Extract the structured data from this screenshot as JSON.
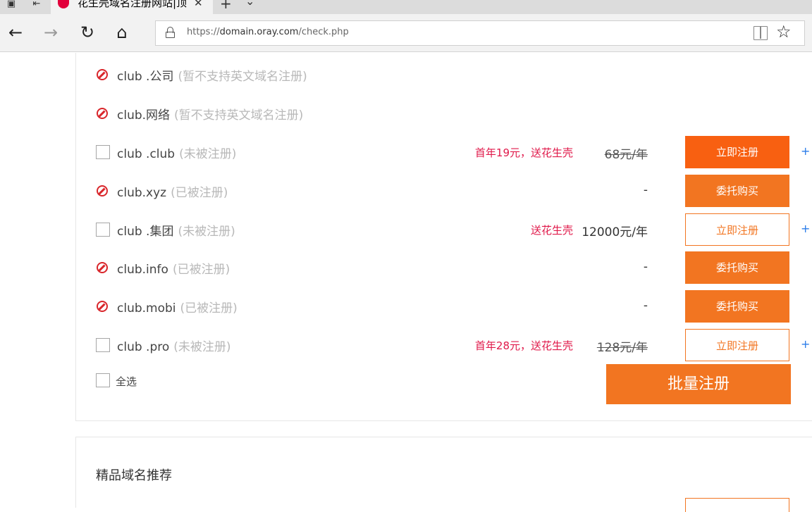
{
  "browser": {
    "tab_title": "花生壳域名注册网站|顶",
    "new_tab_symbol": "+",
    "address_url_prefix": "https://",
    "address_url_domain": "domain.oray.com",
    "address_url_path": "/check.php"
  },
  "rows": [
    {
      "type": "blocked",
      "domain": "club .公司",
      "status": "(暂不支持英文域名注册)"
    },
    {
      "type": "blocked",
      "domain": "club.网络",
      "status": "(暂不支持英文域名注册)"
    },
    {
      "type": "available",
      "domain": "club .club",
      "status": "(未被注册)",
      "promo": "首年19元，送花生壳",
      "price": "68元/年",
      "price_struck": true,
      "button": "立即注册",
      "button_style": "solid2",
      "plus": "+"
    },
    {
      "type": "taken",
      "domain": "club.xyz",
      "status": "(已被注册)",
      "promo": "",
      "price": "-",
      "price_struck": false,
      "button": "委托购买",
      "button_style": "solid"
    },
    {
      "type": "available",
      "domain": "club .集团",
      "status": "(未被注册)",
      "promo": "送花生壳",
      "price": "12000元/年",
      "price_struck": false,
      "button": "立即注册",
      "button_style": "outline",
      "plus": "+"
    },
    {
      "type": "taken",
      "domain": "club.info",
      "status": "(已被注册)",
      "promo": "",
      "price": "-",
      "price_struck": false,
      "button": "委托购买",
      "button_style": "solid"
    },
    {
      "type": "taken",
      "domain": "club.mobi",
      "status": "(已被注册)",
      "promo": "",
      "price": "-",
      "price_struck": false,
      "button": "委托购买",
      "button_style": "solid"
    },
    {
      "type": "available",
      "domain": "club .pro",
      "status": "(未被注册)",
      "promo": "首年28元，送花生壳",
      "price": "128元/年",
      "price_struck": true,
      "button": "立即注册",
      "button_style": "outline",
      "plus": "+"
    }
  ],
  "select_all_label": "全选",
  "bulk_register_label": "批量注册",
  "recommend_title": "精品域名推荐",
  "colors": {
    "accent": "#f27521",
    "promo": "#e0194a",
    "blocked_icon": "#d9262b",
    "plus": "#2b7de9"
  }
}
